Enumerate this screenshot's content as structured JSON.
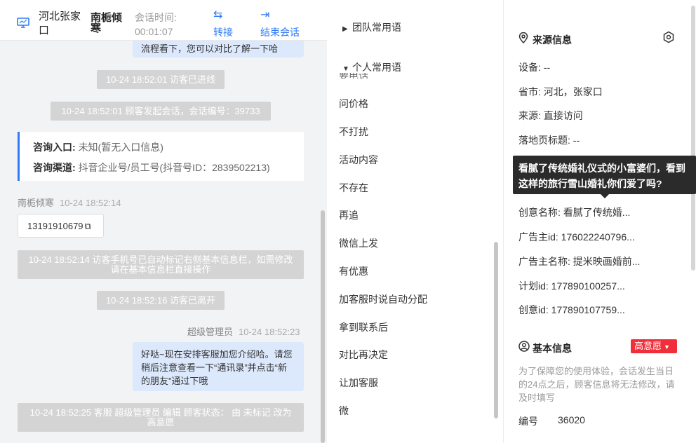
{
  "header": {
    "location": "河北张家口",
    "visitor_name": "南栀倾寒",
    "time_label": "会话时间:",
    "time_value": "00:01:07",
    "transfer_label": "转接",
    "end_label": "结束会话"
  },
  "chat": {
    "messages": {
      "agent_top_tail": "流程看下，您可以对比了解一下哈",
      "sys_entered": "10-24 18:52:01 访客已进线",
      "sys_session": "10-24 18:52:01 顾客发起会话，会话编号：39733",
      "inquiry_entry_key": "咨询入口:",
      "inquiry_entry_val": "未知(暂无入口信息)",
      "inquiry_channel_key": "咨询渠道:",
      "inquiry_channel_val": "抖音企业号/员工号(抖音号ID：2839502213)",
      "visitor_sender": "南栀倾寒",
      "visitor_time": "10-24 18:52:14",
      "phone": "13191910679",
      "sys_phone_note": "10-24 18:52:14 访客手机号已自动标记右侧基本信息栏，如需修改请在基本信息栏直接操作",
      "sys_left": "10-24 18:52:16 访客已离开",
      "admin_sender": "超级管理员",
      "admin_time": "10-24 18:52:23",
      "admin_msg": "好哒~现在安排客服加您介绍哈。请您稍后注意查看一下“通讯录”并点击“新的朋友”通过下哦",
      "sys_edit": "10-24 18:52:25 客服 超级管理员 编辑 顾客状态： 由 未标记 改为 高意愿"
    }
  },
  "phrases": {
    "team_group": "团队常用语",
    "personal_group": "个人常用语",
    "partial_top": "要电话",
    "items": [
      "问价格",
      "不打扰",
      "活动内容",
      "不存在",
      "再追",
      "微信上发",
      "有优惠",
      "加客服时说自动分配",
      "拿到联系后",
      "对比再决定",
      "让加客服",
      "微"
    ]
  },
  "source": {
    "title": "来源信息",
    "device": "设备: --",
    "province": "省市: 河北，张家口",
    "origin": "来源: 直接访问",
    "landing": "落地页标题: --",
    "creative_name": "创意名称: 看腻了传统婚...",
    "advertiser_id": "广告主id: 176022240796...",
    "advertiser_name": "广告主名称: 提米映画婚前...",
    "plan_id": "计划id: 177890100257...",
    "creative_id": "创意id: 177890107759..."
  },
  "tooltip": {
    "text": "看腻了传统婚礼仪式的小富婆们，看到这样的旅行雪山婚礼你们爱了吗?"
  },
  "basic": {
    "title": "基本信息",
    "intent_badge": "高意愿",
    "note": "为了保障您的使用体验，会话发生当日的24点之后，顾客信息将无法修改，请及时填写",
    "number_label": "编号",
    "number_value": "36020"
  },
  "colors": {
    "accent": "#2f7bf5",
    "badge": "#f02f3a",
    "system_msg": "#d4d4d4",
    "agent_bubble": "#dce8fc"
  }
}
